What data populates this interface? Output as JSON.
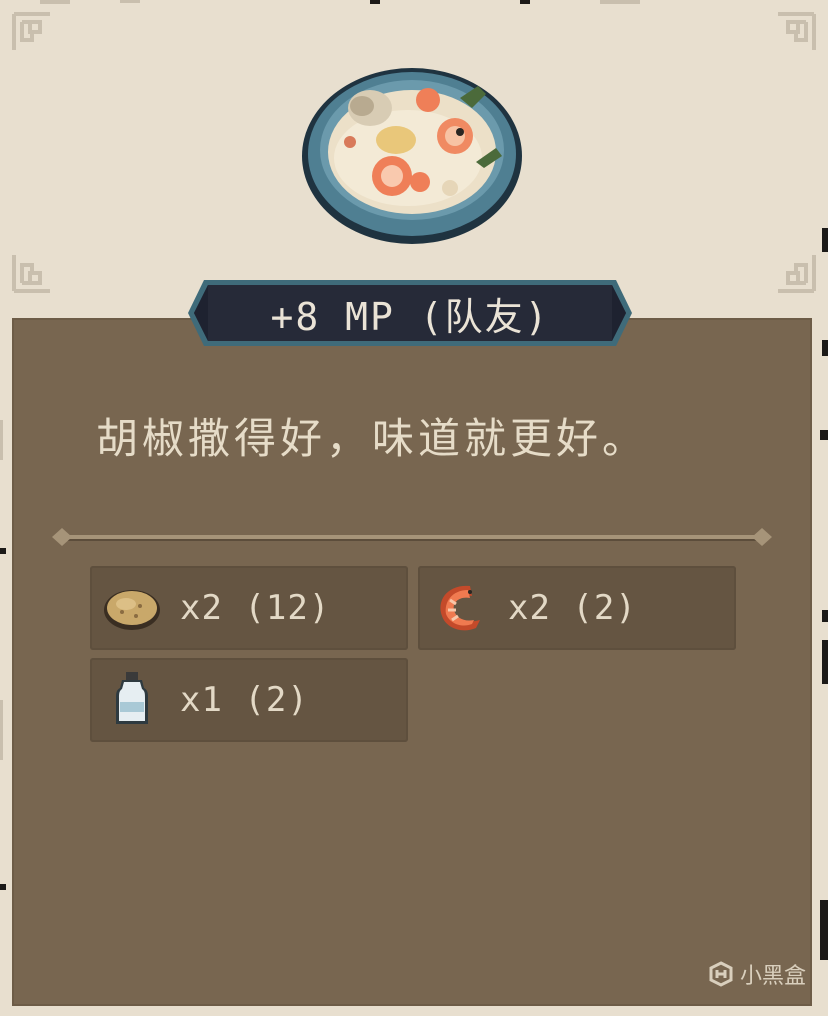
{
  "card": {
    "effect": "+8 MP (队友)",
    "description": "胡椒撒得好，味道就更好。"
  },
  "ingredients": [
    {
      "icon": "potato-icon",
      "quantity": "x2 (12)"
    },
    {
      "icon": "shrimp-icon",
      "quantity": "x2 (2)"
    },
    {
      "icon": "milk-bottle-icon",
      "quantity": "x1 (2)"
    }
  ],
  "watermark": {
    "text": "小黑盒"
  },
  "colors": {
    "card_background": "#e8dfcf",
    "panel": "#786650",
    "ingredient_slot": "#655542",
    "banner": "#262a38",
    "banner_border": "#3f6b7a",
    "text_light": "#e6dcc8"
  }
}
